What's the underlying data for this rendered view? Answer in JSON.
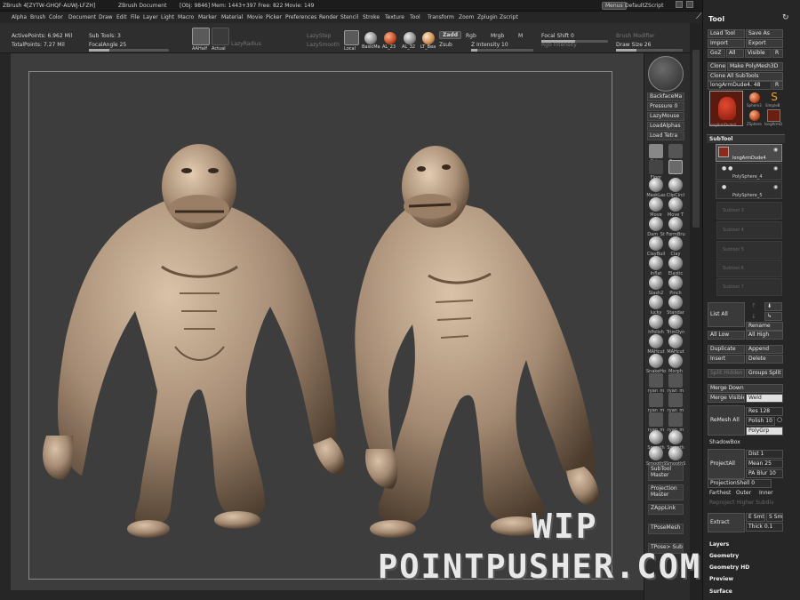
{
  "titlebar": {
    "app": "ZBrush 4[ZYTW-GHQF-AUWJ-LFZH]",
    "doc": "ZBrush Document",
    "stats": "[Obj: 9846] Mem: 1443+397 Free: 822 Movie: 149",
    "menus_btn": "Menus",
    "script": "DefaultZScript"
  },
  "menubar": [
    "Alpha",
    "Brush",
    "Color",
    "Document",
    "Draw",
    "Edit",
    "File",
    "Layer",
    "Light",
    "Macro",
    "Marker",
    "Material",
    "Movie",
    "Picker",
    "Preferences",
    "Render",
    "Stencil",
    "Stroke",
    "Texture",
    "Tool",
    "Transform",
    "Zoom",
    "Zplugin",
    "Zscript"
  ],
  "shelf": {
    "active_points": "ActivePoints: 6.962 Mil",
    "total_points": "TotalPoints: 7.27 Mil",
    "subtools": "Sub Tools: 3",
    "focal_angle": "FocalAngle 25",
    "aahalf": "AAHalf",
    "actual": "Actual",
    "lazy_radius": "LazyRadius",
    "lazy_step": "LazyStep",
    "lazy_smooth": "LazySmooth",
    "local": "Local",
    "materials": [
      "BasicMa",
      "AL_23",
      "AL_32",
      "LT_Bea"
    ],
    "zadd": "Zadd",
    "zsub": "Zsub",
    "rgb": "Rgb",
    "mrgb": "Mrgb",
    "m": "M",
    "z_intensity": "Z Intensity 10",
    "rgb_intensity": "Rgb Intensity",
    "focal_shift": "Focal Shift 0",
    "brush_modifier": "Brush Modifier",
    "draw_size": "Draw Size 26"
  },
  "right_shelf": {
    "backface": "BackfaceMa",
    "pressure": "Pressure 0",
    "lazymouse": "LazyMouse",
    "loadalpha": "LoadAlphas",
    "loadtetra": "Load Tetra",
    "top_labels": [
      "Color",
      "Persp"
    ],
    "floor": "Floor",
    "brushes": [
      "MaskLas",
      "ClipCircl",
      "Move",
      "Move T",
      "Dam_St",
      "FormBru",
      "ClayBuil",
      "Clay",
      "Inflat",
      "Elastic",
      "Slash2",
      "Pinch",
      "lucky",
      "Standar",
      "hPolish",
      "TrimDyn",
      "MAHcut",
      "MAHcut",
      "SnakeHo",
      "Morph",
      "ryan_m",
      "ryan_m",
      "ryan_m",
      "ryan_m",
      "ryan_m",
      "ryan_m",
      "Smooth",
      "Smooth",
      "SmoothS",
      "SmoothS"
    ],
    "subtool_master": "SubTool Master",
    "projection_master": "Projection Master",
    "zapplink": "ZAppLink",
    "tposemesh": "TPoseMesh",
    "tpose_subt": "TPose> SubT"
  },
  "tool_panel": {
    "title": "Tool",
    "load_tool": "Load Tool",
    "save_as": "Save As",
    "import": "Import",
    "export": "Export",
    "goz": "GoZ",
    "all": "All",
    "visible": "Visible",
    "r": "R",
    "clone": "Clone",
    "make_polymesh": "Make PolyMesh3D",
    "clone_all": "Clone All SubTools",
    "current_tool": "longArmDude4. 48",
    "thumbs": [
      "longArmDude4.",
      "Sphere3",
      "SimpleB",
      "ZSphere",
      "longArmD"
    ],
    "subtool_header": "SubTool",
    "subtools": [
      "longArmDude4",
      "PolySphere_4",
      "PolySphere_5"
    ],
    "empty_subtools": [
      "Subtool 3",
      "Subtool 4",
      "Subtool 5",
      "Subtool 6",
      "Subtool 7"
    ],
    "list_all": "List All",
    "rename": "Rename",
    "all_low": "All Low",
    "all_high": "All High",
    "duplicate": "Duplicate",
    "append": "Append",
    "insert": "Insert",
    "delete": "Delete",
    "split_hidden": "Split Hidden",
    "groups_split": "Groups Split",
    "merge_down": "Merge Down",
    "merge_visible": "Merge Visible",
    "weld": "Weld",
    "remesh_all": "ReMesh All",
    "res": "Res 128",
    "polish": "Polish 10",
    "polygrp": "PolyGrp",
    "shadowbox": "ShadowBox",
    "project_all": "ProjectAll",
    "dist": "Dist 1",
    "mean": "Mean 25",
    "pa_blur": "PA Blur 10",
    "projection_shell": "ProjectionShell 0",
    "farthest": "Farthest",
    "outer": "Outer",
    "inner": "Inner",
    "reproject": "Reproject Higher Subdiv",
    "extract": "Extract",
    "e_smt": "E Smt 5",
    "s_smt": "S Smt",
    "thick": "Thick 0.1",
    "layers": "Layers",
    "geometry": "Geometry",
    "geometry_hd": "Geometry HD",
    "preview": "Preview",
    "surface": "Surface"
  },
  "watermark": {
    "line1": "WIP",
    "line2": "POINTPUSHER.COM"
  },
  "colors": {
    "clay": "#a48a72",
    "ui_bg": "#2b2b2b",
    "canvas": "#3d3d3d",
    "accent_red": "#b2301c"
  }
}
